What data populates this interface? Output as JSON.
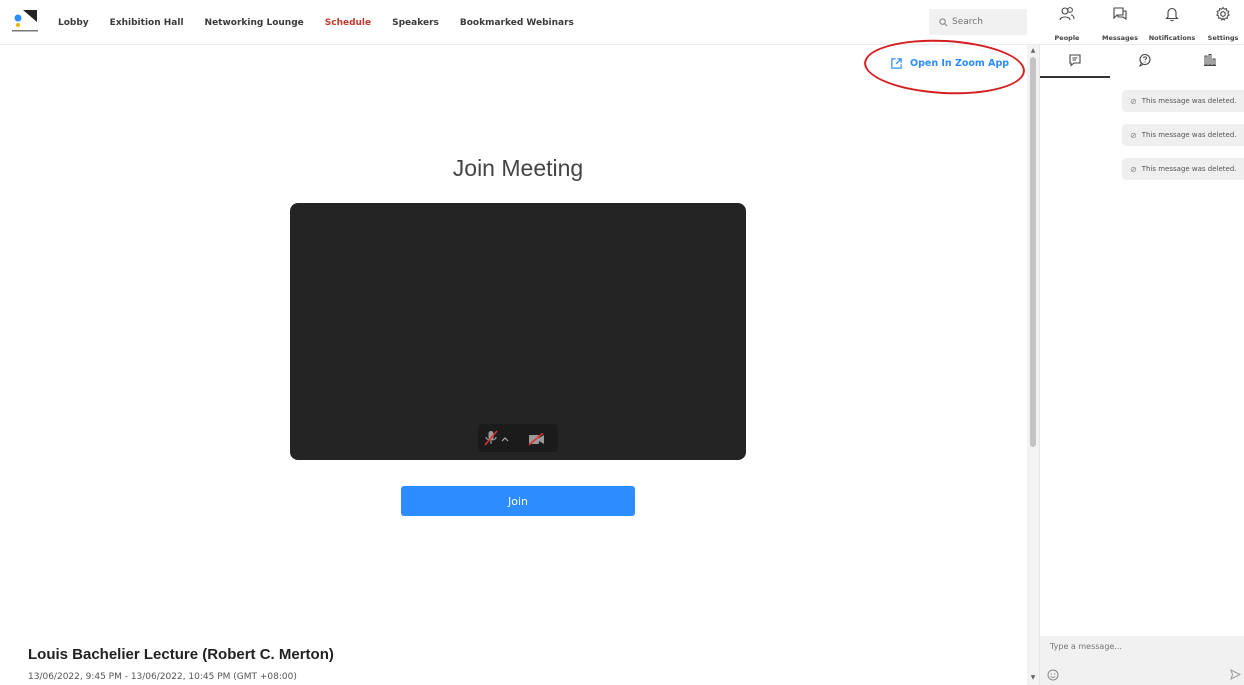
{
  "nav": {
    "items": [
      {
        "label": "Lobby"
      },
      {
        "label": "Exhibition Hall"
      },
      {
        "label": "Networking Lounge"
      },
      {
        "label": "Schedule",
        "active": true
      },
      {
        "label": "Speakers"
      },
      {
        "label": "Bookmarked Webinars"
      }
    ],
    "active_color": "#c0392b"
  },
  "search": {
    "placeholder": "Search",
    "icon": "search-icon"
  },
  "toolbar": {
    "people_label": "People",
    "messages_label": "Messages",
    "notifications_label": "Notifications",
    "settings_label": "Settings"
  },
  "main": {
    "open_zoom_label": "Open In Zoom App",
    "join_title": "Join Meeting",
    "join_button_label": "Join",
    "accent_color": "#2d8cff",
    "event_title": "Louis Bachelier Lecture (Robert C. Merton)",
    "event_time": "13/06/2022, 9:45 PM - 13/06/2022, 10:45 PM (GMT +08:00)"
  },
  "chat": {
    "messages": [
      {
        "text": "This message was deleted."
      },
      {
        "text": "This message was deleted."
      },
      {
        "text": "This message was deleted."
      }
    ],
    "input_placeholder": "Type a message..."
  }
}
